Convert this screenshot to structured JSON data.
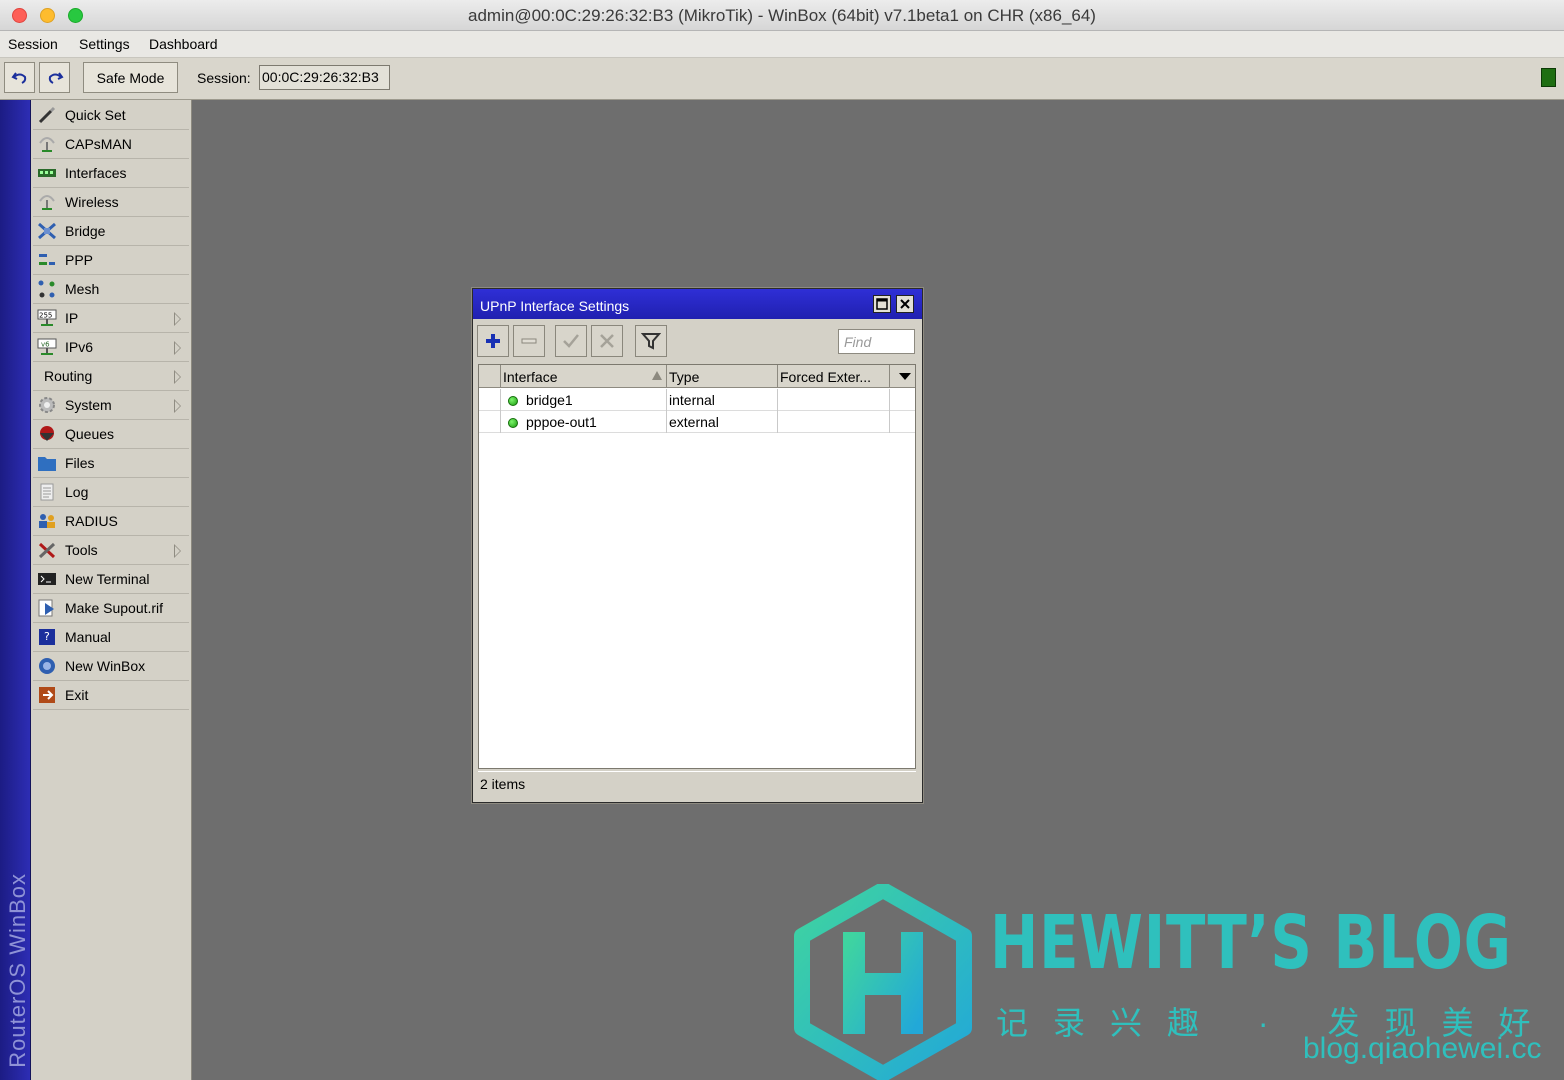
{
  "window": {
    "title": "admin@00:0C:29:26:32:B3 (MikroTik) - WinBox (64bit) v7.1beta1 on CHR (x86_64)"
  },
  "menubar": {
    "items": [
      "Session",
      "Settings",
      "Dashboard"
    ]
  },
  "toolbar": {
    "undo_icon": "undo-icon",
    "redo_icon": "redo-icon",
    "safe_mode_label": "Safe Mode",
    "session_label": "Session:",
    "session_value": "00:0C:29:26:32:B3",
    "status_led_color": "#1e6e12"
  },
  "sidebar": {
    "vertical_label": "RouterOS WinBox",
    "items": [
      {
        "label": "Quick Set",
        "icon": "wand-icon",
        "submenu": false
      },
      {
        "label": "CAPsMAN",
        "icon": "antenna-icon",
        "submenu": false
      },
      {
        "label": "Interfaces",
        "icon": "interface-card-icon",
        "submenu": false
      },
      {
        "label": "Wireless",
        "icon": "antenna-icon",
        "submenu": false
      },
      {
        "label": "Bridge",
        "icon": "bridge-icon",
        "submenu": false
      },
      {
        "label": "PPP",
        "icon": "ppp-icon",
        "submenu": false
      },
      {
        "label": "Mesh",
        "icon": "mesh-icon",
        "submenu": false
      },
      {
        "label": "IP",
        "icon": "ip-icon",
        "submenu": true
      },
      {
        "label": "IPv6",
        "icon": "ipv6-icon",
        "submenu": true
      },
      {
        "label": "Routing",
        "icon": "",
        "submenu": true
      },
      {
        "label": "System",
        "icon": "gear-icon",
        "submenu": true
      },
      {
        "label": "Queues",
        "icon": "queues-icon",
        "submenu": false
      },
      {
        "label": "Files",
        "icon": "folder-icon",
        "submenu": false
      },
      {
        "label": "Log",
        "icon": "log-icon",
        "submenu": false
      },
      {
        "label": "RADIUS",
        "icon": "users-icon",
        "submenu": false
      },
      {
        "label": "Tools",
        "icon": "tools-icon",
        "submenu": true
      },
      {
        "label": "New Terminal",
        "icon": "terminal-icon",
        "submenu": false
      },
      {
        "label": "Make Supout.rif",
        "icon": "supout-icon",
        "submenu": false
      },
      {
        "label": "Manual",
        "icon": "manual-icon",
        "submenu": false
      },
      {
        "label": "New WinBox",
        "icon": "globe-icon",
        "submenu": false
      },
      {
        "label": "Exit",
        "icon": "exit-icon",
        "submenu": false
      }
    ]
  },
  "dialog": {
    "title": "UPnP Interface Settings",
    "find_placeholder": "Find",
    "columns": [
      "Interface",
      "Type",
      "Forced Exter..."
    ],
    "rows": [
      {
        "interface": "bridge1",
        "type": "internal",
        "forced_external": ""
      },
      {
        "interface": "pppoe-out1",
        "type": "external",
        "forced_external": ""
      }
    ],
    "status": "2 items"
  },
  "watermark": {
    "title": "HEWITT’S BLOG",
    "subtitle": "记录兴趣 · 发现美好",
    "url": "blog.qiaohewei.cc",
    "color": "#2fc0bd"
  }
}
